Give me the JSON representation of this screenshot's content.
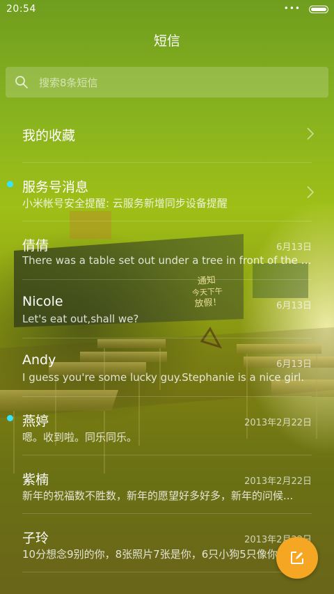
{
  "status": {
    "time": "20:54",
    "dots": "•••"
  },
  "header": {
    "title": "短信"
  },
  "search": {
    "placeholder": "搜索8条短信"
  },
  "favorites": {
    "label": "我的收藏"
  },
  "conversations": [
    {
      "name": "服务号消息",
      "preview": "小米帐号安全提醒: 云服务新增同步设备提醒",
      "date": "",
      "unread": true
    },
    {
      "name": "倩倩",
      "preview": "There was a table set out under a tree in front of the ho...",
      "date": "6月13日",
      "unread": false
    },
    {
      "name": "Nicole",
      "preview": "Let's eat out,shall we?",
      "date": "6月13日",
      "unread": false
    },
    {
      "name": "Andy",
      "preview": "I guess you're some lucky guy.Stephanie is a nice girl.",
      "date": "6月13日",
      "unread": false
    },
    {
      "name": "燕婷",
      "preview": "嗯。收到啦。同乐同乐。",
      "date": "2013年2月22日",
      "unread": true
    },
    {
      "name": "紫楠",
      "preview": "新年的祝福数不胜数，新年的愿望好多好多，新年的问候...",
      "date": "2013年2月22日",
      "unread": false
    },
    {
      "name": "子玲",
      "preview": "10分想念9别的你，8张照片7张是你，6只小狗5只像你",
      "date": "2013年2月22日",
      "unread": false
    }
  ],
  "wallpaper": {
    "board_text": [
      "通知",
      "今天下午",
      "放假！"
    ]
  },
  "colors": {
    "unread_dot": "#35e4ff",
    "fab": "#f5a623"
  },
  "icons": {
    "search": "search-icon",
    "compose": "compose-icon",
    "chevron": "chevron-right-icon"
  }
}
